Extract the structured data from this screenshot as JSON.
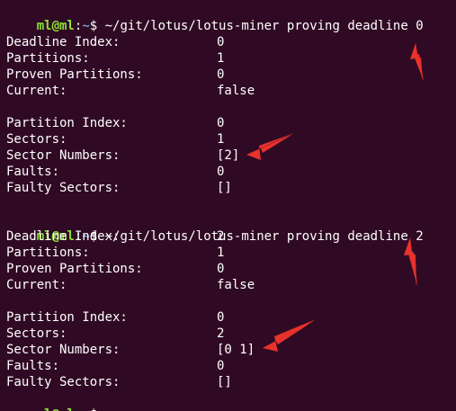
{
  "prompt": {
    "user": "ml@ml",
    "colon": ":",
    "path": "~",
    "dollar": "$"
  },
  "blocks": [
    {
      "command": " ~/git/lotus/lotus-miner proving deadline 0",
      "deadline_rows": [
        {
          "label": "Deadline Index:",
          "value": "0"
        },
        {
          "label": "Partitions:",
          "value": "1"
        },
        {
          "label": "Proven Partitions:",
          "value": "0"
        },
        {
          "label": "Current:",
          "value": "false"
        }
      ],
      "partition_rows": [
        {
          "label": "Partition Index:",
          "value": "0"
        },
        {
          "label": "Sectors:",
          "value": "1"
        },
        {
          "label": "Sector Numbers:",
          "value": "[2]"
        },
        {
          "label": "Faults:",
          "value": "0"
        },
        {
          "label": "Faulty Sectors:",
          "value": "[]"
        }
      ]
    },
    {
      "command": " ~/git/lotus/lotus-miner proving deadline 2",
      "deadline_rows": [
        {
          "label": "Deadline Index:",
          "value": "2"
        },
        {
          "label": "Partitions:",
          "value": "1"
        },
        {
          "label": "Proven Partitions:",
          "value": "0"
        },
        {
          "label": "Current:",
          "value": "false"
        }
      ],
      "partition_rows": [
        {
          "label": "Partition Index:",
          "value": "0"
        },
        {
          "label": "Sectors:",
          "value": "2"
        },
        {
          "label": "Sector Numbers:",
          "value": "[0 1]"
        },
        {
          "label": "Faults:",
          "value": "0"
        },
        {
          "label": "Faulty Sectors:",
          "value": "[]"
        }
      ]
    }
  ],
  "colors": {
    "background": "#300a24",
    "prompt_user": "#8ae234",
    "prompt_path": "#729fcf",
    "text": "#ffffff",
    "annotation_arrow": "#e8322b"
  },
  "icons": [
    "annotation-arrow-icon"
  ]
}
